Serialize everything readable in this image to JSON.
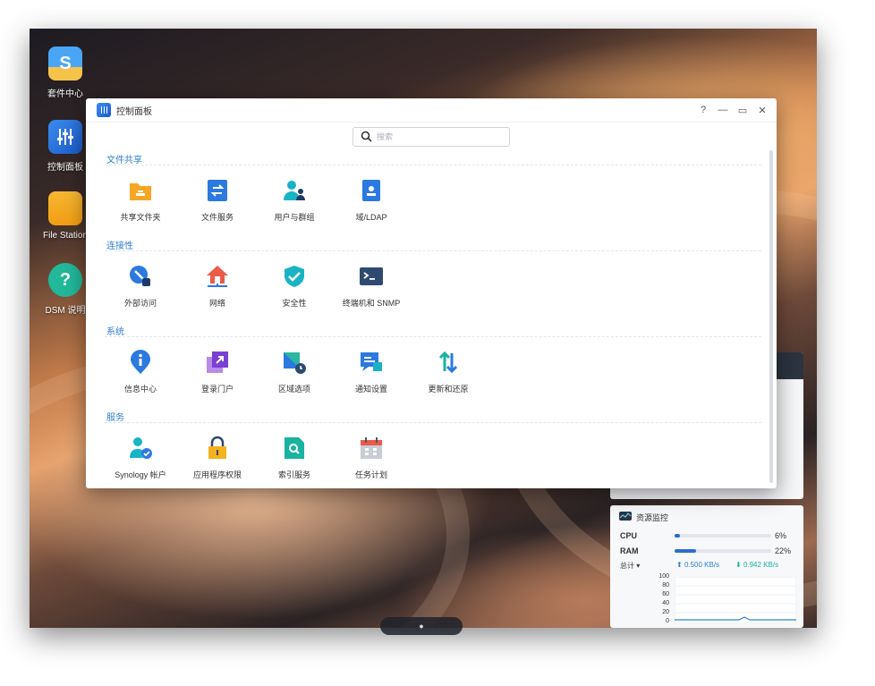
{
  "desktop": {
    "icons": [
      {
        "label": "套件中心"
      },
      {
        "label": "控制面板"
      },
      {
        "label": "File Station"
      },
      {
        "label": "DSM 说明"
      }
    ]
  },
  "window": {
    "title": "控制面板",
    "controls": {
      "help": "?",
      "minimize": "—",
      "maximize": "▭",
      "close": "✕"
    }
  },
  "search": {
    "placeholder": "搜索"
  },
  "sections": [
    {
      "title": "文件共享",
      "items": [
        {
          "label": "共享文件夹",
          "icon": "shared-folder-icon"
        },
        {
          "label": "文件服务",
          "icon": "file-services-icon"
        },
        {
          "label": "用户与群组",
          "icon": "users-groups-icon"
        },
        {
          "label": "域/LDAP",
          "icon": "domain-ldap-icon"
        }
      ]
    },
    {
      "title": "连接性",
      "items": [
        {
          "label": "外部访问",
          "icon": "external-access-icon"
        },
        {
          "label": "网络",
          "icon": "network-icon"
        },
        {
          "label": "安全性",
          "icon": "security-shield-icon"
        },
        {
          "label": "终端机和 SNMP",
          "icon": "terminal-icon"
        }
      ]
    },
    {
      "title": "系统",
      "items": [
        {
          "label": "信息中心",
          "icon": "info-center-icon"
        },
        {
          "label": "登录门户",
          "icon": "login-portal-icon"
        },
        {
          "label": "区域选项",
          "icon": "regional-options-icon"
        },
        {
          "label": "通知设置",
          "icon": "notification-icon"
        },
        {
          "label": "更新和还原",
          "icon": "update-restore-icon"
        }
      ]
    },
    {
      "title": "服务",
      "items": [
        {
          "label": "Synology 帐户",
          "icon": "synology-account-icon"
        },
        {
          "label": "应用程序权限",
          "icon": "app-privileges-icon"
        },
        {
          "label": "索引服务",
          "icon": "indexing-service-icon"
        },
        {
          "label": "任务计划",
          "icon": "task-scheduler-icon"
        }
      ]
    }
  ],
  "resource_monitor": {
    "title": "资源监控",
    "cpu": {
      "label": "CPU",
      "value": "6%",
      "fraction": 0.06
    },
    "ram": {
      "label": "RAM",
      "value": "22%",
      "fraction": 0.22
    },
    "total_label": "总计 ▾",
    "upload": "0.500 KB/s",
    "download": "0.942 KB/s",
    "chart_ticks": [
      "100",
      "80",
      "60",
      "40",
      "20",
      "0"
    ]
  },
  "colors": {
    "accent": "#2f7fd1",
    "folder_orange": "#f5a623",
    "teal": "#19b3c6"
  }
}
